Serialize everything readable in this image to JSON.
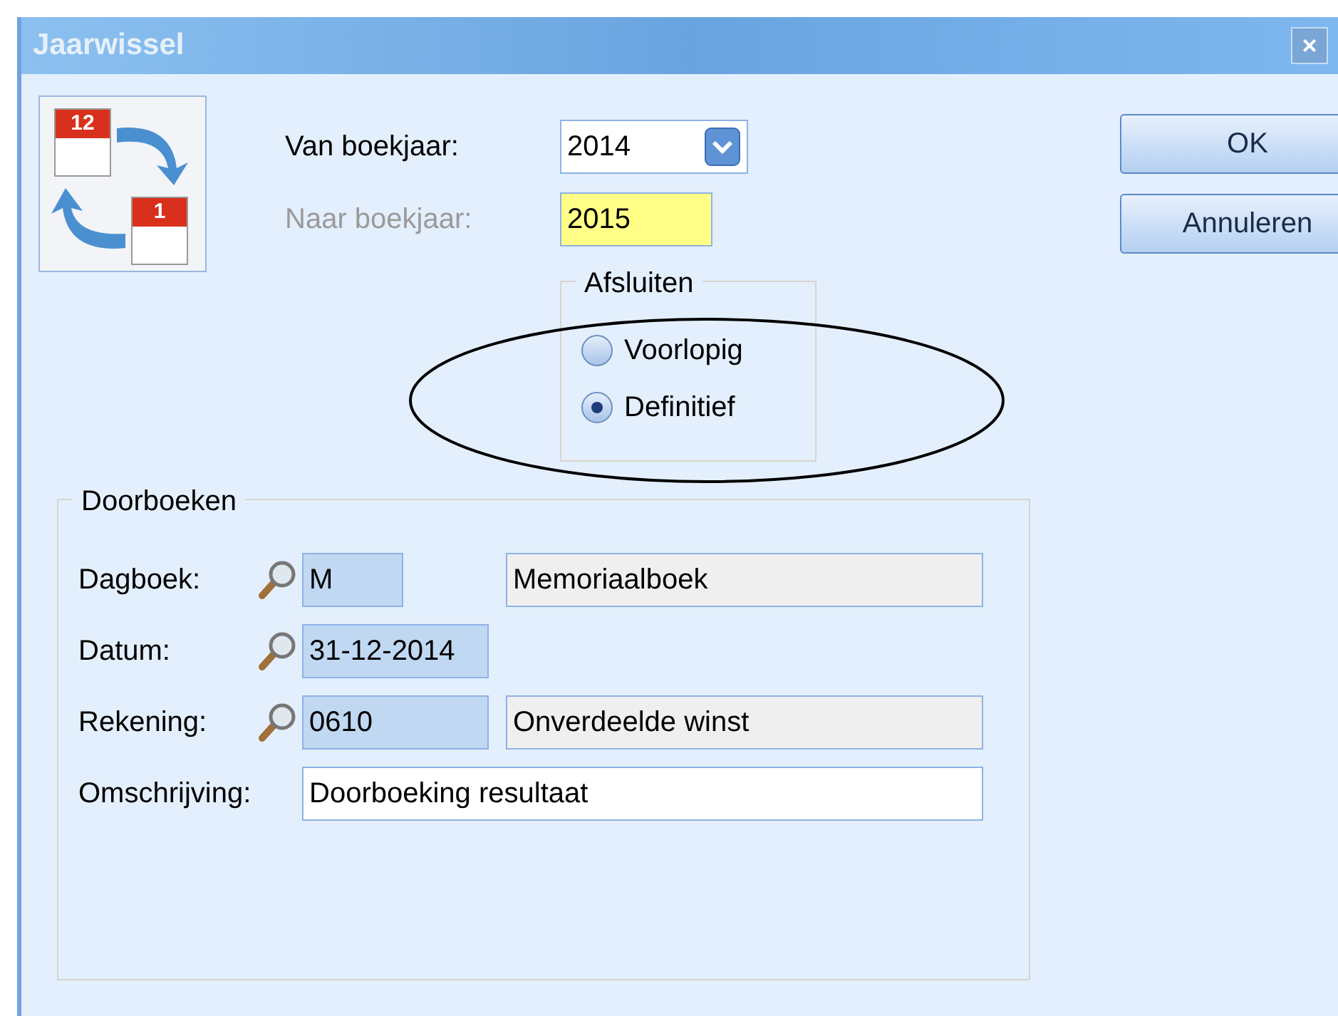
{
  "window": {
    "title": "Jaarwissel",
    "close": "×"
  },
  "icon_labels": [
    "12",
    "1"
  ],
  "from_year": {
    "label": "Van boekjaar:",
    "value": "2014"
  },
  "to_year": {
    "label": "Naar boekjaar:",
    "value": "2015",
    "disabled": true
  },
  "closing": {
    "title": "Afsluiten",
    "options": [
      {
        "label": "Voorlopig",
        "selected": false
      },
      {
        "label": "Definitief",
        "selected": true
      }
    ]
  },
  "buttons": [
    "OK",
    "Annuleren"
  ],
  "posting": {
    "title": "Doorboeken",
    "rows": [
      {
        "kind": "lookup",
        "label": "Dagboek:",
        "code": "M",
        "description": "Memoriaalboek"
      },
      {
        "kind": "date",
        "label": "Datum:",
        "code": "31-12-2014"
      },
      {
        "kind": "lookup",
        "label": "Rekening:",
        "code": "0610",
        "description": "Onverdeelde winst"
      },
      {
        "kind": "text",
        "label": "Omschrijving:",
        "value": "Doorboeking resultaat"
      }
    ]
  }
}
